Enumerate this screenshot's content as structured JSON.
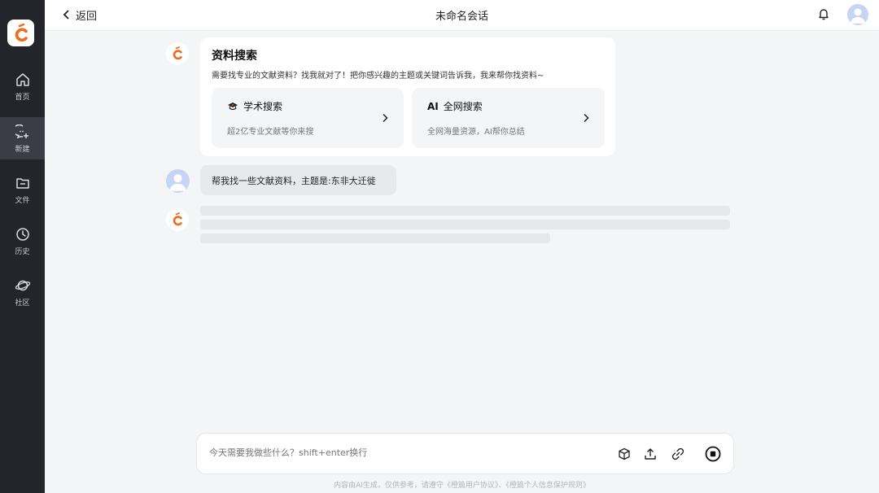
{
  "sidebar": {
    "items": [
      {
        "label": "首页",
        "icon": "home-icon"
      },
      {
        "label": "新建",
        "icon": "new-chat-icon"
      },
      {
        "label": "文件",
        "icon": "file-icon"
      },
      {
        "label": "历史",
        "icon": "history-icon"
      },
      {
        "label": "社区",
        "icon": "planet-icon"
      }
    ],
    "active_index": 1
  },
  "header": {
    "back_label": "返回",
    "title": "未命名会话"
  },
  "bot_card": {
    "title": "资料搜索",
    "subtitle": "需要找专业的文献资料？找我就对了！把你感兴趣的主题或关键词告诉我，我来帮你找资料~",
    "options": [
      {
        "title": "学术搜索",
        "description": "超2亿专业文献等你来搜",
        "icon": "graduation-cap-icon"
      },
      {
        "title": "全网搜索",
        "description": "全网海量资源，AI帮你总结",
        "icon": "ai-icon",
        "icon_text": "AI"
      }
    ]
  },
  "user_message": "帮我找一些文献资料，主题是:东非大迁徙",
  "input": {
    "placeholder": "今天需要我做些什么？shift+enter换行",
    "tools": [
      "cube-icon",
      "upload-icon",
      "link-icon",
      "stop-icon"
    ]
  },
  "footer_note": "内容由AI生成，仅供参考，请遵守《橙篇用户协议》、《橙篇个人信息保护规则》",
  "colors": {
    "brand_orange": "#f26a1b",
    "sidebar_bg": "#23252b",
    "page_bg": "#f4f5f7"
  }
}
